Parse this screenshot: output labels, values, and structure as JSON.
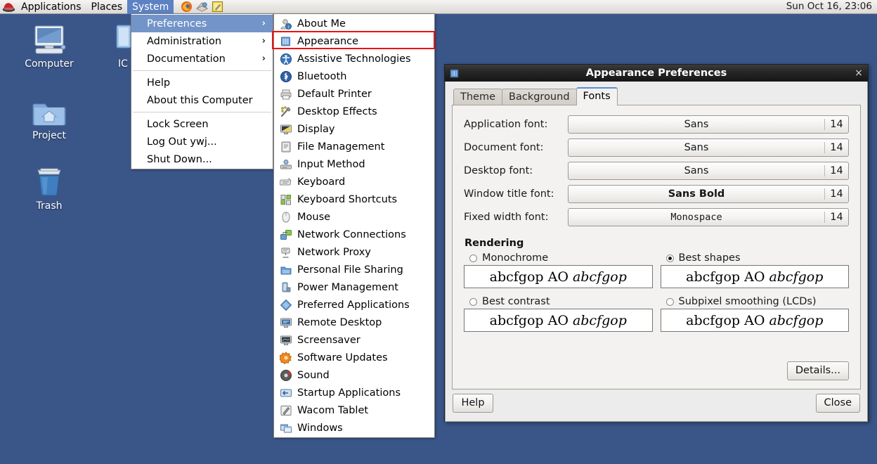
{
  "panel": {
    "menus": [
      {
        "label": "Applications",
        "active": false
      },
      {
        "label": "Places",
        "active": false
      },
      {
        "label": "System",
        "active": true
      }
    ],
    "launchers": [
      {
        "name": "firefox-icon"
      },
      {
        "name": "evolution-mail-icon"
      },
      {
        "name": "text-editor-icon"
      }
    ],
    "clock": "Sun Oct 16, 23:06"
  },
  "desktop": {
    "icons": [
      {
        "label": "Computer",
        "icon": "computer-icon"
      },
      {
        "label": "Project",
        "icon": "home-folder-icon"
      },
      {
        "label": "Trash",
        "icon": "trash-icon"
      },
      {
        "label": "IC",
        "icon": "document-icon"
      }
    ]
  },
  "system_menu": {
    "items": [
      {
        "label": "Preferences",
        "submenu": true,
        "selected": true,
        "arrow": "›"
      },
      {
        "label": "Administration",
        "submenu": true,
        "selected": false,
        "arrow": "›"
      },
      {
        "label": "Documentation",
        "submenu": true,
        "selected": false,
        "arrow": "›"
      },
      {
        "separator": true
      },
      {
        "label": "Help",
        "submenu": false,
        "selected": false
      },
      {
        "label": "About this Computer",
        "submenu": false,
        "selected": false
      },
      {
        "separator": true
      },
      {
        "label": "Lock Screen",
        "submenu": false,
        "selected": false
      },
      {
        "label": "Log Out ywj...",
        "submenu": false,
        "selected": false
      },
      {
        "label": "Shut Down...",
        "submenu": false,
        "selected": false
      }
    ]
  },
  "preferences_menu": {
    "highlight_color": "#ee1111",
    "items": [
      {
        "label": "About Me",
        "icon": "about-me-icon"
      },
      {
        "label": "Appearance",
        "icon": "appearance-icon",
        "highlighted": true
      },
      {
        "label": "Assistive Technologies",
        "icon": "assistive-technologies-icon"
      },
      {
        "label": "Bluetooth",
        "icon": "bluetooth-icon"
      },
      {
        "label": "Default Printer",
        "icon": "printer-icon"
      },
      {
        "label": "Desktop Effects",
        "icon": "desktop-effects-icon"
      },
      {
        "label": "Display",
        "icon": "display-icon"
      },
      {
        "label": "File Management",
        "icon": "file-management-icon"
      },
      {
        "label": "Input Method",
        "icon": "input-method-icon"
      },
      {
        "label": "Keyboard",
        "icon": "keyboard-icon"
      },
      {
        "label": "Keyboard Shortcuts",
        "icon": "keyboard-shortcuts-icon"
      },
      {
        "label": "Mouse",
        "icon": "mouse-icon"
      },
      {
        "label": "Network Connections",
        "icon": "network-connections-icon"
      },
      {
        "label": "Network Proxy",
        "icon": "network-proxy-icon"
      },
      {
        "label": "Personal File Sharing",
        "icon": "file-sharing-icon"
      },
      {
        "label": "Power Management",
        "icon": "power-management-icon"
      },
      {
        "label": "Preferred Applications",
        "icon": "preferred-applications-icon"
      },
      {
        "label": "Remote Desktop",
        "icon": "remote-desktop-icon"
      },
      {
        "label": "Screensaver",
        "icon": "screensaver-icon"
      },
      {
        "label": "Software Updates",
        "icon": "software-updates-icon"
      },
      {
        "label": "Sound",
        "icon": "sound-icon"
      },
      {
        "label": "Startup Applications",
        "icon": "startup-applications-icon"
      },
      {
        "label": "Wacom Tablet",
        "icon": "wacom-tablet-icon"
      },
      {
        "label": "Windows",
        "icon": "windows-icon"
      }
    ]
  },
  "dialog": {
    "title": "Appearance Preferences",
    "close_label": "×",
    "tabs": [
      {
        "label": "Theme",
        "active": false
      },
      {
        "label": "Background",
        "active": false
      },
      {
        "label": "Fonts",
        "active": true
      }
    ],
    "fonts": [
      {
        "label": "Application font:",
        "font": "Sans",
        "size": "14",
        "style": "normal"
      },
      {
        "label": "Document font:",
        "font": "Sans",
        "size": "14",
        "style": "normal"
      },
      {
        "label": "Desktop font:",
        "font": "Sans",
        "size": "14",
        "style": "normal"
      },
      {
        "label": "Window title font:",
        "font": "Sans Bold",
        "size": "14",
        "style": "bold"
      },
      {
        "label": "Fixed width font:",
        "font": "Monospace",
        "size": "14",
        "style": "mono"
      }
    ],
    "rendering": {
      "title": "Rendering",
      "sample_prefix": "abcfgop AO ",
      "sample_italic": "abcfgop",
      "options": [
        {
          "label": "Monochrome",
          "selected": false
        },
        {
          "label": "Best shapes",
          "selected": true
        },
        {
          "label": "Best contrast",
          "selected": false
        },
        {
          "label": "Subpixel smoothing (LCDs)",
          "selected": false
        }
      ]
    },
    "details_label": "Details...",
    "help_label": "Help",
    "close_button_label": "Close"
  }
}
